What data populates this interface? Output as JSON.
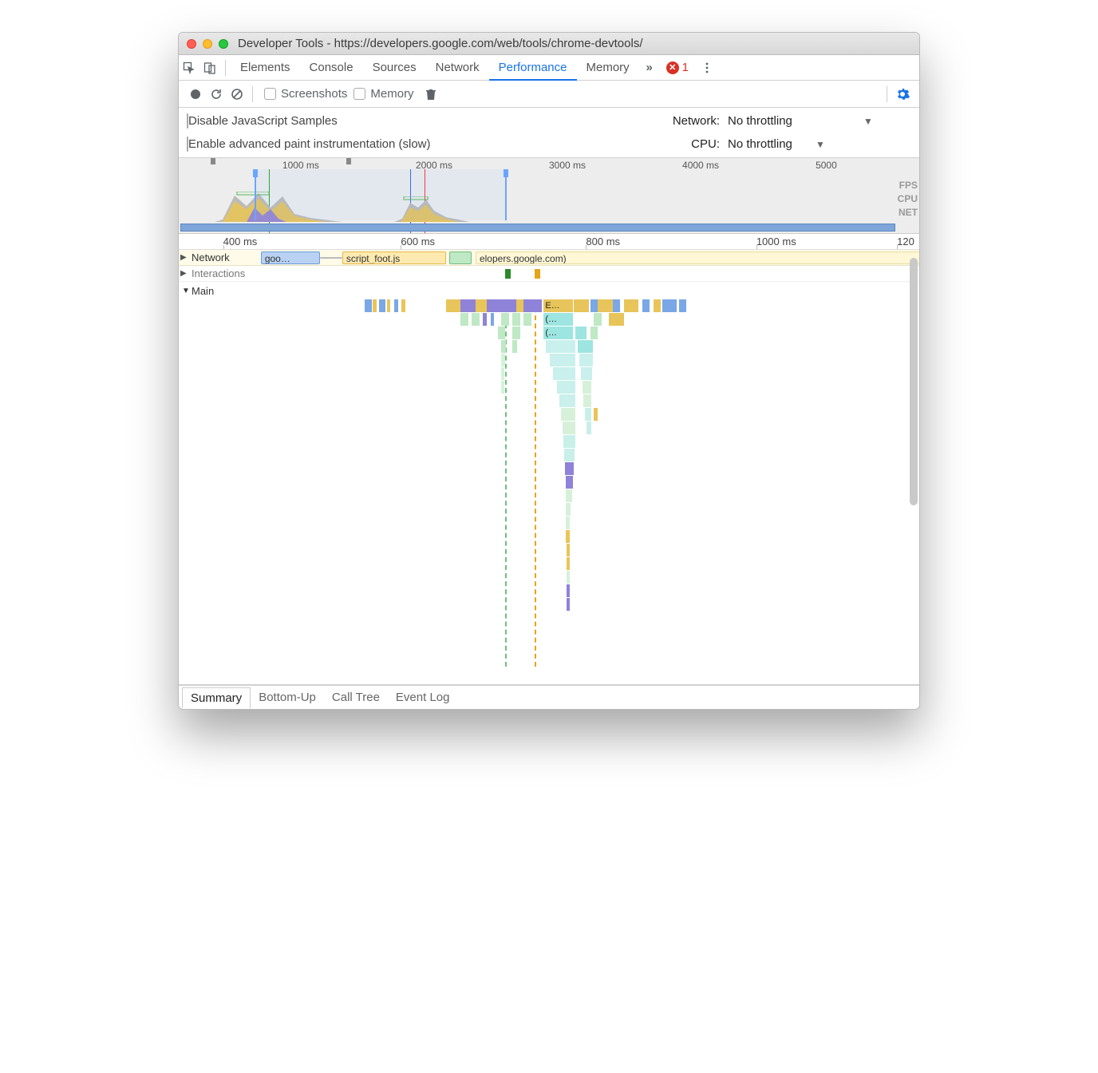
{
  "window": {
    "title": "Developer Tools - https://developers.google.com/web/tools/chrome-devtools/"
  },
  "tabs": {
    "items": [
      "Elements",
      "Console",
      "Sources",
      "Network",
      "Performance",
      "Memory"
    ],
    "active_index": 4,
    "overflow_icon": "chevrons-right-icon",
    "error_count": "1"
  },
  "toolbar": {
    "screenshots_label": "Screenshots",
    "memory_label": "Memory"
  },
  "throttle": {
    "disable_js_label": "Disable JavaScript Samples",
    "enable_paint_label": "Enable advanced paint instrumentation (slow)",
    "network_label": "Network:",
    "network_value": "No throttling",
    "cpu_label": "CPU:",
    "cpu_value": "No throttling"
  },
  "overview": {
    "ticks": [
      {
        "label": "1000 ms",
        "left_pct": 14
      },
      {
        "label": "2000 ms",
        "left_pct": 32
      },
      {
        "label": "3000 ms",
        "left_pct": 50
      },
      {
        "label": "4000 ms",
        "left_pct": 68
      },
      {
        "label": "5000",
        "left_pct": 86
      }
    ],
    "lane_labels": [
      "FPS",
      "CPU",
      "NET"
    ]
  },
  "ruler": {
    "ticks": [
      {
        "label": "400 ms",
        "left_pct": 6
      },
      {
        "label": "600 ms",
        "left_pct": 30
      },
      {
        "label": "800 ms",
        "left_pct": 55
      },
      {
        "label": "1000 ms",
        "left_pct": 78
      },
      {
        "label": "120",
        "left_pct": 97
      }
    ]
  },
  "network_lane": {
    "header": "Network",
    "chips": [
      {
        "label": "goo…",
        "left_pct": 3,
        "width_pct": 8,
        "bg": "#b9d2f3",
        "bd": "#6a9be0"
      },
      {
        "label": "script_foot.js",
        "left_pct": 14,
        "width_pct": 14,
        "bg": "#fdeab1",
        "bd": "#e6b74a"
      },
      {
        "label": "",
        "left_pct": 28.5,
        "width_pct": 3,
        "bg": "#bfe8c5",
        "bd": "#6fbf7d"
      },
      {
        "label": "elopers.google.com)",
        "left_pct": 32,
        "width_pct": 60,
        "bg": "#fff7d6",
        "bd": "#e8dca0"
      }
    ]
  },
  "interactions_lane": {
    "label": "Interactions",
    "bars": [
      {
        "left_pct": 36,
        "width_pct": 0.7,
        "bg": "#2a8a2a"
      },
      {
        "left_pct": 40,
        "width_pct": 0.7,
        "bg": "#e6a514"
      }
    ]
  },
  "main_section": {
    "label": "Main"
  },
  "flame": {
    "labels": {
      "e": "E…",
      "p1": "(…",
      "p2": "(…"
    },
    "dashed": [
      {
        "left_pct": 36,
        "color": "#6fbf7d"
      },
      {
        "left_pct": 40,
        "color": "#e6a514"
      }
    ],
    "row0": [
      {
        "left_pct": 17,
        "width_pct": 1,
        "bg": "#7aa7e6"
      },
      {
        "left_pct": 18.1,
        "width_pct": 0.5,
        "bg": "#e8c55a"
      },
      {
        "left_pct": 19,
        "width_pct": 0.8,
        "bg": "#7aa7e6"
      },
      {
        "left_pct": 20,
        "width_pct": 0.5,
        "bg": "#e8c55a"
      },
      {
        "left_pct": 21,
        "width_pct": 0.5,
        "bg": "#7aa7e6"
      },
      {
        "left_pct": 22,
        "width_pct": 0.5,
        "bg": "#e8c55a"
      },
      {
        "left_pct": 28,
        "width_pct": 2,
        "bg": "#e8c55a"
      },
      {
        "left_pct": 30,
        "width_pct": 2,
        "bg": "#8f82d9"
      },
      {
        "left_pct": 32,
        "width_pct": 1.5,
        "bg": "#e8c55a"
      },
      {
        "left_pct": 33.5,
        "width_pct": 2,
        "bg": "#8f82d9"
      },
      {
        "left_pct": 35.5,
        "width_pct": 2,
        "bg": "#8f82d9"
      },
      {
        "left_pct": 37.5,
        "width_pct": 1,
        "bg": "#e8c55a"
      },
      {
        "left_pct": 38.5,
        "width_pct": 2.5,
        "bg": "#8f82d9"
      },
      {
        "left_pct": 41.2,
        "width_pct": 4,
        "bg": "#e8c55a",
        "label": "e"
      },
      {
        "left_pct": 45.3,
        "width_pct": 2,
        "bg": "#e8c55a"
      },
      {
        "left_pct": 47.5,
        "width_pct": 1,
        "bg": "#7aa7e6"
      },
      {
        "left_pct": 48.5,
        "width_pct": 2,
        "bg": "#e8c55a"
      },
      {
        "left_pct": 50.5,
        "width_pct": 1,
        "bg": "#7aa7e6"
      },
      {
        "left_pct": 52,
        "width_pct": 2,
        "bg": "#e8c55a"
      },
      {
        "left_pct": 54.5,
        "width_pct": 1,
        "bg": "#7aa7e6"
      },
      {
        "left_pct": 56,
        "width_pct": 1,
        "bg": "#e8c55a"
      },
      {
        "left_pct": 57.2,
        "width_pct": 2,
        "bg": "#7aa7e6"
      },
      {
        "left_pct": 59.5,
        "width_pct": 1,
        "bg": "#7aa7e6"
      }
    ],
    "row1": [
      {
        "left_pct": 30,
        "width_pct": 1,
        "bg": "#bfe8c5"
      },
      {
        "left_pct": 31.5,
        "width_pct": 1,
        "bg": "#bfe8c5"
      },
      {
        "left_pct": 33,
        "width_pct": 0.5,
        "bg": "#8f82d9"
      },
      {
        "left_pct": 34,
        "width_pct": 0.5,
        "bg": "#7aa7e6"
      },
      {
        "left_pct": 35.5,
        "width_pct": 1,
        "bg": "#bfe8c5"
      },
      {
        "left_pct": 37,
        "width_pct": 1,
        "bg": "#bfe8c5"
      },
      {
        "left_pct": 38.5,
        "width_pct": 1,
        "bg": "#bfe8c5"
      },
      {
        "left_pct": 41.2,
        "width_pct": 4,
        "bg": "#9de5e0",
        "label": "p1"
      },
      {
        "left_pct": 48,
        "width_pct": 1,
        "bg": "#bfe8c5"
      },
      {
        "left_pct": 50,
        "width_pct": 2,
        "bg": "#e8c55a"
      }
    ],
    "row2": [
      {
        "left_pct": 35,
        "width_pct": 1,
        "bg": "#bfe8c5"
      },
      {
        "left_pct": 37,
        "width_pct": 1,
        "bg": "#bfe8c5"
      },
      {
        "left_pct": 41.2,
        "width_pct": 4,
        "bg": "#9de5e0",
        "label": "p2"
      },
      {
        "left_pct": 45.5,
        "width_pct": 1.5,
        "bg": "#9de5e0"
      },
      {
        "left_pct": 47.5,
        "width_pct": 1,
        "bg": "#bfe8c5"
      }
    ],
    "row3": [
      {
        "left_pct": 35.5,
        "width_pct": 0.6,
        "bg": "#bfe8c5"
      },
      {
        "left_pct": 37,
        "width_pct": 0.6,
        "bg": "#bfe8c5"
      },
      {
        "left_pct": 41.5,
        "width_pct": 4,
        "bg": "#c9f0ec"
      },
      {
        "left_pct": 45.8,
        "width_pct": 2,
        "bg": "#9de5e0"
      }
    ],
    "row4": [
      {
        "left_pct": 35.5,
        "width_pct": 0.5,
        "bg": "#d7f0da"
      },
      {
        "left_pct": 42,
        "width_pct": 3.5,
        "bg": "#c9f0ec"
      },
      {
        "left_pct": 46,
        "width_pct": 1.8,
        "bg": "#c9f0ec"
      }
    ],
    "row5": [
      {
        "left_pct": 35.5,
        "width_pct": 0.4,
        "bg": "#d7f0da"
      },
      {
        "left_pct": 42.5,
        "width_pct": 3,
        "bg": "#c9f0ec"
      },
      {
        "left_pct": 46.2,
        "width_pct": 1.5,
        "bg": "#c9f0ec"
      }
    ],
    "row6": [
      {
        "left_pct": 35.5,
        "width_pct": 0.3,
        "bg": "#d7f0da"
      },
      {
        "left_pct": 43,
        "width_pct": 2.5,
        "bg": "#c9f0ec"
      },
      {
        "left_pct": 46.4,
        "width_pct": 1.2,
        "bg": "#d7f0da"
      }
    ],
    "row7": [
      {
        "left_pct": 43.3,
        "width_pct": 2.2,
        "bg": "#c9f0ec"
      },
      {
        "left_pct": 46.6,
        "width_pct": 1,
        "bg": "#d7f0da"
      }
    ],
    "row8": [
      {
        "left_pct": 43.5,
        "width_pct": 2,
        "bg": "#d7f0da"
      },
      {
        "left_pct": 46.8,
        "width_pct": 0.8,
        "bg": "#c9efe9"
      },
      {
        "left_pct": 48,
        "width_pct": 0.5,
        "bg": "#e8c55a"
      }
    ],
    "row9": [
      {
        "left_pct": 43.7,
        "width_pct": 1.8,
        "bg": "#d7f0da"
      },
      {
        "left_pct": 47,
        "width_pct": 0.6,
        "bg": "#c9efe9"
      }
    ],
    "row10": [
      {
        "left_pct": 43.9,
        "width_pct": 1.6,
        "bg": "#c9efe9"
      }
    ],
    "row11": [
      {
        "left_pct": 44,
        "width_pct": 1.4,
        "bg": "#c9efe9"
      }
    ],
    "row12": [
      {
        "left_pct": 44.1,
        "width_pct": 1.2,
        "bg": "#8f82d9"
      }
    ],
    "row13": [
      {
        "left_pct": 44.2,
        "width_pct": 1,
        "bg": "#8f82d9"
      }
    ],
    "row14": [
      {
        "left_pct": 44.2,
        "width_pct": 0.8,
        "bg": "#d7f0da"
      }
    ],
    "row15": [
      {
        "left_pct": 44.2,
        "width_pct": 0.6,
        "bg": "#d7f0da"
      }
    ],
    "row16": [
      {
        "left_pct": 44.2,
        "width_pct": 0.5,
        "bg": "#d7f0da"
      }
    ],
    "row17": [
      {
        "left_pct": 44.2,
        "width_pct": 0.5,
        "bg": "#e8c55a"
      }
    ],
    "row18": [
      {
        "left_pct": 44.3,
        "width_pct": 0.4,
        "bg": "#e8c55a"
      }
    ],
    "row19": [
      {
        "left_pct": 44.3,
        "width_pct": 0.3,
        "bg": "#e8c55a"
      }
    ],
    "row20": [
      {
        "left_pct": 44.3,
        "width_pct": 0.3,
        "bg": "#d7f0da"
      }
    ],
    "row21": [
      {
        "left_pct": 44.3,
        "width_pct": 0.3,
        "bg": "#8f82d9"
      }
    ],
    "row22": [
      {
        "left_pct": 44.3,
        "width_pct": 0.3,
        "bg": "#8f82d9"
      }
    ]
  },
  "bottom_tabs": {
    "items": [
      "Summary",
      "Bottom-Up",
      "Call Tree",
      "Event Log"
    ],
    "active_index": 0
  }
}
